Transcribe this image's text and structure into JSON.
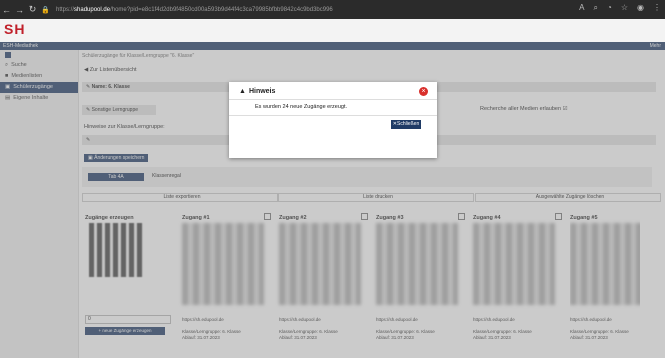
{
  "browser": {
    "url_host": "shadupool.de",
    "url_prefix": "https://",
    "url_rest": "/home?pid=e8c1f4d2db9f4850cd00a593b9d44f4c3ca79985bfbb9842c4c9bd3bc996"
  },
  "app": {
    "logo_text": "SH",
    "blueband_label": "ESH-Mediathek",
    "user_label": "Mehr"
  },
  "sidebar": {
    "items": [
      {
        "label": "Suche",
        "icon": "search-icon"
      },
      {
        "label": "Medienlisten",
        "icon": "bookmark-icon"
      },
      {
        "label": "Schülerzugänge",
        "icon": "users-icon"
      },
      {
        "label": "Eigene Inhalte",
        "icon": "folder-icon"
      }
    ]
  },
  "main": {
    "breadcrumb": "Schülerzugänge für Klasse/Lerngruppe \"6. Klasse\"",
    "back_link": "Zur Listenübersicht",
    "name_label": "Name: 6. Klasse",
    "sonstige_label": "Sonstige Lerngruppe",
    "recherche_label": "Recherche aller Medien erlauben",
    "hinweise_label": "Hinweise zur Klasse/Lerngruppe:",
    "save_button": "Änderungen speichern",
    "tab_active": "Tab 4A",
    "tab_inactive": "Klassenregal",
    "list_export": "Liste exportieren",
    "list_print": "Liste drucken",
    "delete_selected": "Ausgewählte Zugänge löschen",
    "create_label": "Zugänge erzeugen",
    "count_value": "0",
    "new_button": "neue Zugänge erzeugen"
  },
  "cards": [
    {
      "title": "Zugang #1",
      "url": "https://sh.edupool.de",
      "group": "Klasse/Lerngruppe: 6. Klasse",
      "expiry": "Ablauf: 31.07.2023"
    },
    {
      "title": "Zugang #2",
      "url": "https://sh.edupool.de",
      "group": "Klasse/Lerngruppe: 6. Klasse",
      "expiry": "Ablauf: 31.07.2023"
    },
    {
      "title": "Zugang #3",
      "url": "https://sh.edupool.de",
      "group": "Klasse/Lerngruppe: 6. Klasse",
      "expiry": "Ablauf: 31.07.2023"
    },
    {
      "title": "Zugang #4",
      "url": "https://sh.edupool.de",
      "group": "Klasse/Lerngruppe: 6. Klasse",
      "expiry": "Ablauf: 31.07.2023"
    },
    {
      "title": "Zugang #5",
      "url": "https://sh.edupool.de",
      "group": "Klasse/Lerngruppe: 6. Klasse",
      "expiry": "Ablauf: 31.07.2023"
    }
  ],
  "dialog": {
    "title": "Hinweis",
    "message": "Es wurden 24 neue Zugänge erzeugt.",
    "close_button": "Schließen"
  }
}
